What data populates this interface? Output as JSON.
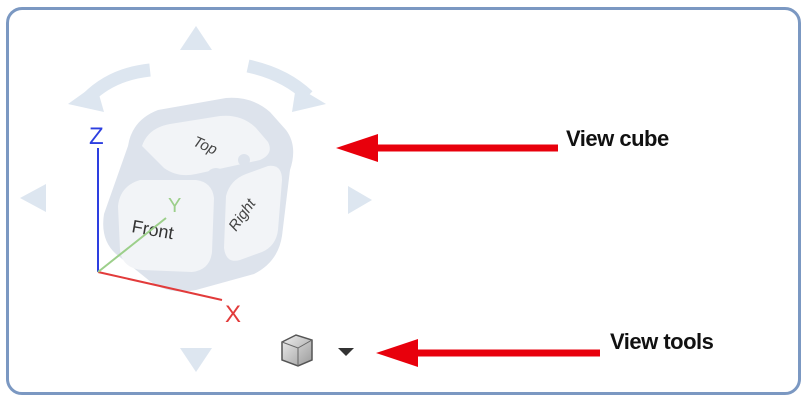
{
  "viewcube": {
    "faces": {
      "top": "Top",
      "front": "Front",
      "right": "Right"
    },
    "axes": {
      "x": "X",
      "y": "Y",
      "z": "Z"
    }
  },
  "annotations": {
    "view_cube": "View cube",
    "view_tools": "View tools"
  },
  "colors": {
    "frame_border": "#7b98c2",
    "cube_tint": "#dde3ec",
    "nav_arrow_tint": "#dde6f0",
    "axis_x": "#e23b3b",
    "axis_y": "#9ccf8a",
    "axis_z": "#2d3fe0",
    "callout_arrow": "#e8000c"
  },
  "icons": {
    "view_tools_icon": "cube-icon",
    "view_tools_dropdown": "caret-down-icon"
  }
}
